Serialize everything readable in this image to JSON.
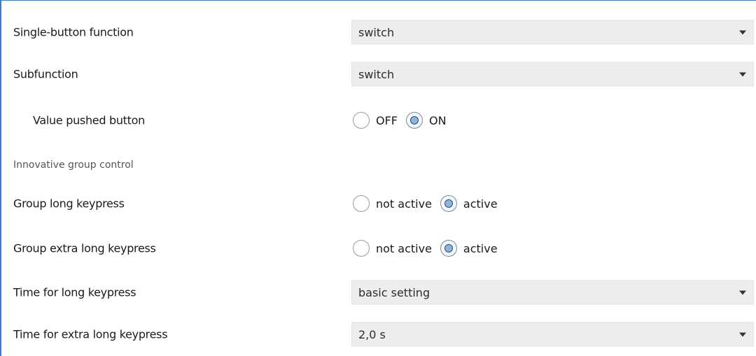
{
  "rows": {
    "single_button_function": {
      "label": "Single-button function",
      "value": "switch"
    },
    "subfunction": {
      "label": "Subfunction",
      "value": "switch"
    },
    "value_pushed_button": {
      "label": "Value pushed button",
      "options": [
        "OFF",
        "ON"
      ],
      "selected": "ON"
    },
    "section": {
      "label": "Innovative group control"
    },
    "group_long_keypress": {
      "label": "Group long keypress",
      "options": [
        "not active",
        "active"
      ],
      "selected": "active"
    },
    "group_extra_long_keypress": {
      "label": "Group extra long keypress",
      "options": [
        "not active",
        "active"
      ],
      "selected": "active"
    },
    "time_long_keypress": {
      "label": "Time for long keypress",
      "value": "basic setting"
    },
    "time_extra_long_keypress": {
      "label": "Time for extra long keypress",
      "value": "2,0 s"
    }
  },
  "icons": {
    "dropdown": "chevron-down-icon",
    "radio_unselected": "radio-unselected-icon",
    "radio_selected": "radio-selected-icon"
  },
  "colors": {
    "accent_border": "#3b7cc6",
    "select_bg": "#ededed",
    "radio_fill": "#8eb3dc"
  }
}
